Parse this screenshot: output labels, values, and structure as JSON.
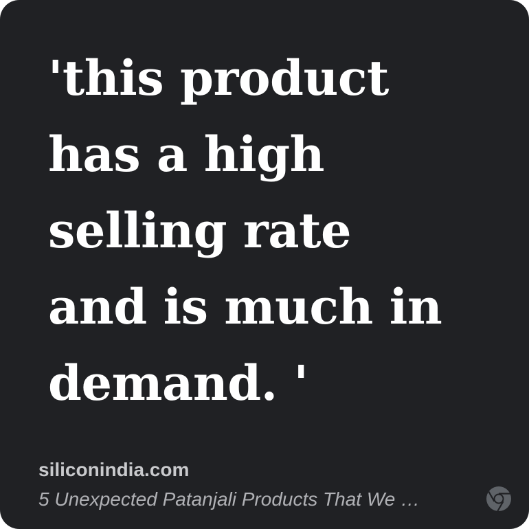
{
  "card": {
    "quote": "'this product\nhas a high\nselling rate\nand is much in\ndemand. '",
    "source": "siliconindia.com",
    "article_title": "5 Unexpected Patanjali Products That We …",
    "icon": "chrome-icon"
  },
  "colors": {
    "background": "#202124",
    "quote_text": "#ffffff",
    "source_text": "#c9cacd",
    "title_text": "#b0b1b5",
    "icon": "#5f6368"
  }
}
